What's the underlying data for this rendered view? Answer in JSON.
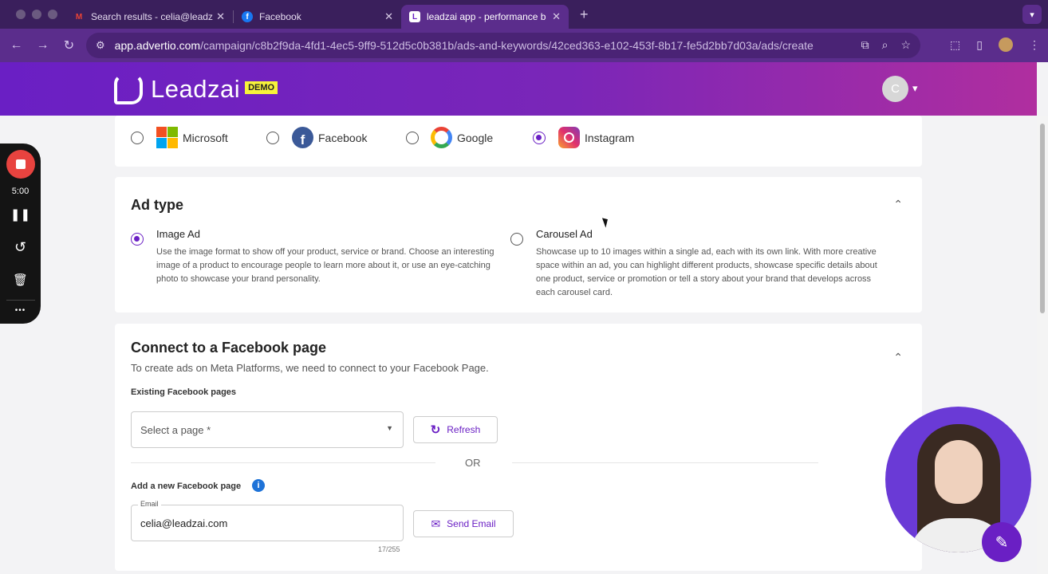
{
  "browser": {
    "tabs": [
      {
        "title": "Search results - celia@leadz",
        "favicon": "gmail-icon",
        "close": "✕"
      },
      {
        "title": "Facebook",
        "favicon": "facebook-icon",
        "close": "✕"
      },
      {
        "title": "leadzai app - performance ba",
        "favicon": "leadzai-icon",
        "close": "✕"
      }
    ],
    "new_tab": "+",
    "url_host": "app.advertio.com",
    "url_path": "/campaign/c8b2f9da-4fd1-4ec5-9ff9-512d5c0b381b/ads-and-keywords/42ced363-e102-453f-8b17-fe5d2bb7d03a/ads/create"
  },
  "header": {
    "logo_text": "Leadzai",
    "badge": "DEMO",
    "user_initial": "C",
    "caret": "▾"
  },
  "platforms": [
    {
      "label": "Microsoft",
      "selected": false
    },
    {
      "label": "Facebook",
      "selected": false
    },
    {
      "label": "Google",
      "selected": false
    },
    {
      "label": "Instagram",
      "selected": true
    }
  ],
  "ad_type": {
    "title": "Ad type",
    "options": [
      {
        "label": "Image Ad",
        "selected": true,
        "description": "Use the image format to show off your product, service or brand. Choose an interesting image of a product to encourage people to learn more about it, or use an eye-catching photo to showcase your brand personality."
      },
      {
        "label": "Carousel Ad",
        "selected": false,
        "description": "Showcase up to 10 images within a single ad, each with its own link. With more creative space within an ad, you can highlight different products, showcase specific details about one product, service or promotion or tell a story about your brand that develops across each carousel card."
      }
    ]
  },
  "connect": {
    "title": "Connect to a Facebook page",
    "subtitle": "To create ads on Meta Platforms, we need to connect to your Facebook Page.",
    "existing_label": "Existing Facebook pages",
    "select_placeholder": "Select a page *",
    "refresh_label": "Refresh",
    "or_text": "OR",
    "add_new_label": "Add a new Facebook page",
    "email_label": "Email",
    "email_value": "celia@leadzai.com",
    "counter": "17/255",
    "send_email_label": "Send Email"
  },
  "recorder": {
    "time": "5:00",
    "more": "•••"
  },
  "colors": {
    "accent": "#6a1fc4",
    "recording": "#e8433f",
    "badge": "#f7f33a"
  }
}
